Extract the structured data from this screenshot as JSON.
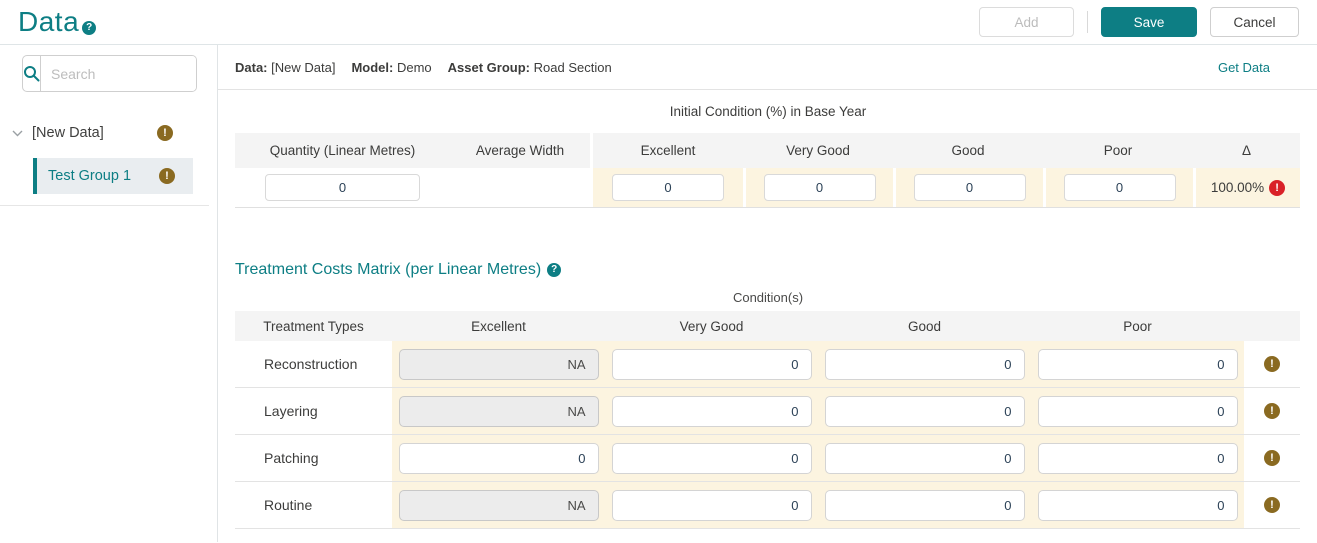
{
  "app": {
    "title": "Data"
  },
  "icons": {
    "help_glyph": "?",
    "warning_glyph": "!",
    "error_glyph": "!"
  },
  "colors": {
    "accent_teal": "#0d7e84",
    "warning_brown": "#8a6a21",
    "error_red": "#d92128",
    "condition_cell_bg": "#fcf4e0",
    "table_header_bg": "#f4f4f4",
    "selected_item_bg": "#e9edf0"
  },
  "toolbar": {
    "add_label": "Add",
    "save_label": "Save",
    "cancel_label": "Cancel"
  },
  "sidebar": {
    "search_placeholder": "Search",
    "tree": {
      "root": {
        "label": "[New Data]",
        "has_warning": true
      },
      "children": [
        {
          "label": "Test Group 1",
          "has_warning": true,
          "selected": true
        }
      ]
    }
  },
  "info_bar": {
    "data_label": "Data:",
    "data_value": "[New Data]",
    "model_label": "Model:",
    "model_value": "Demo",
    "asset_group_label": "Asset Group:",
    "asset_group_value": "Road Section",
    "get_data_label": "Get Data"
  },
  "initial_condition": {
    "title": "Initial Condition (%) in Base Year",
    "columns": [
      "Quantity (Linear Metres)",
      "Average Width",
      "Excellent",
      "Very Good",
      "Good",
      "Poor",
      "Δ"
    ],
    "row": {
      "quantity": "0",
      "average_width": "",
      "excellent": "0",
      "very_good": "0",
      "good": "0",
      "poor": "0",
      "delta": "100.00%",
      "delta_has_error": true
    }
  },
  "treatment_costs": {
    "title": "Treatment Costs Matrix (per Linear Metres)",
    "subtitle": "Condition(s)",
    "columns": [
      "Treatment Types",
      "Excellent",
      "Very Good",
      "Good",
      "Poor"
    ],
    "rows": [
      {
        "name": "Reconstruction",
        "excellent": "NA",
        "excellent_disabled": true,
        "very_good": "0",
        "good": "0",
        "poor": "0",
        "has_warning": true
      },
      {
        "name": "Layering",
        "excellent": "NA",
        "excellent_disabled": true,
        "very_good": "0",
        "good": "0",
        "poor": "0",
        "has_warning": true
      },
      {
        "name": "Patching",
        "excellent": "0",
        "excellent_disabled": false,
        "very_good": "0",
        "good": "0",
        "poor": "0",
        "has_warning": true
      },
      {
        "name": "Routine",
        "excellent": "NA",
        "excellent_disabled": true,
        "very_good": "0",
        "good": "0",
        "poor": "0",
        "has_warning": true
      }
    ]
  }
}
